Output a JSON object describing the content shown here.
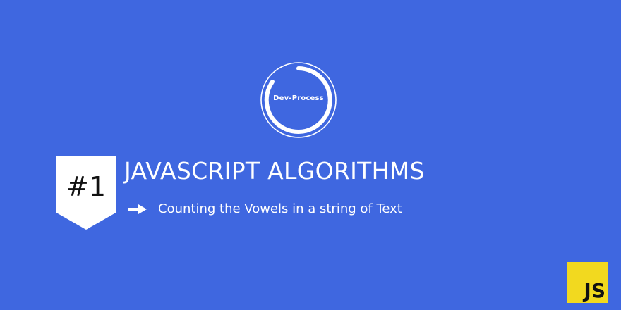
{
  "logo": {
    "text": "Dev-Process",
    "icon": "spinner-ring-icon"
  },
  "badge": {
    "text": "#1"
  },
  "title": "JAVASCRIPT ALGORITHMS",
  "subtitle": {
    "icon": "arrow-right-icon",
    "text": "Counting the Vowels in a string of Text"
  },
  "js_logo": {
    "text": "JS"
  },
  "colors": {
    "background": "#3f67e0",
    "badge": "#ffffff",
    "js_yellow": "#f2d91f",
    "text": "#ffffff"
  }
}
